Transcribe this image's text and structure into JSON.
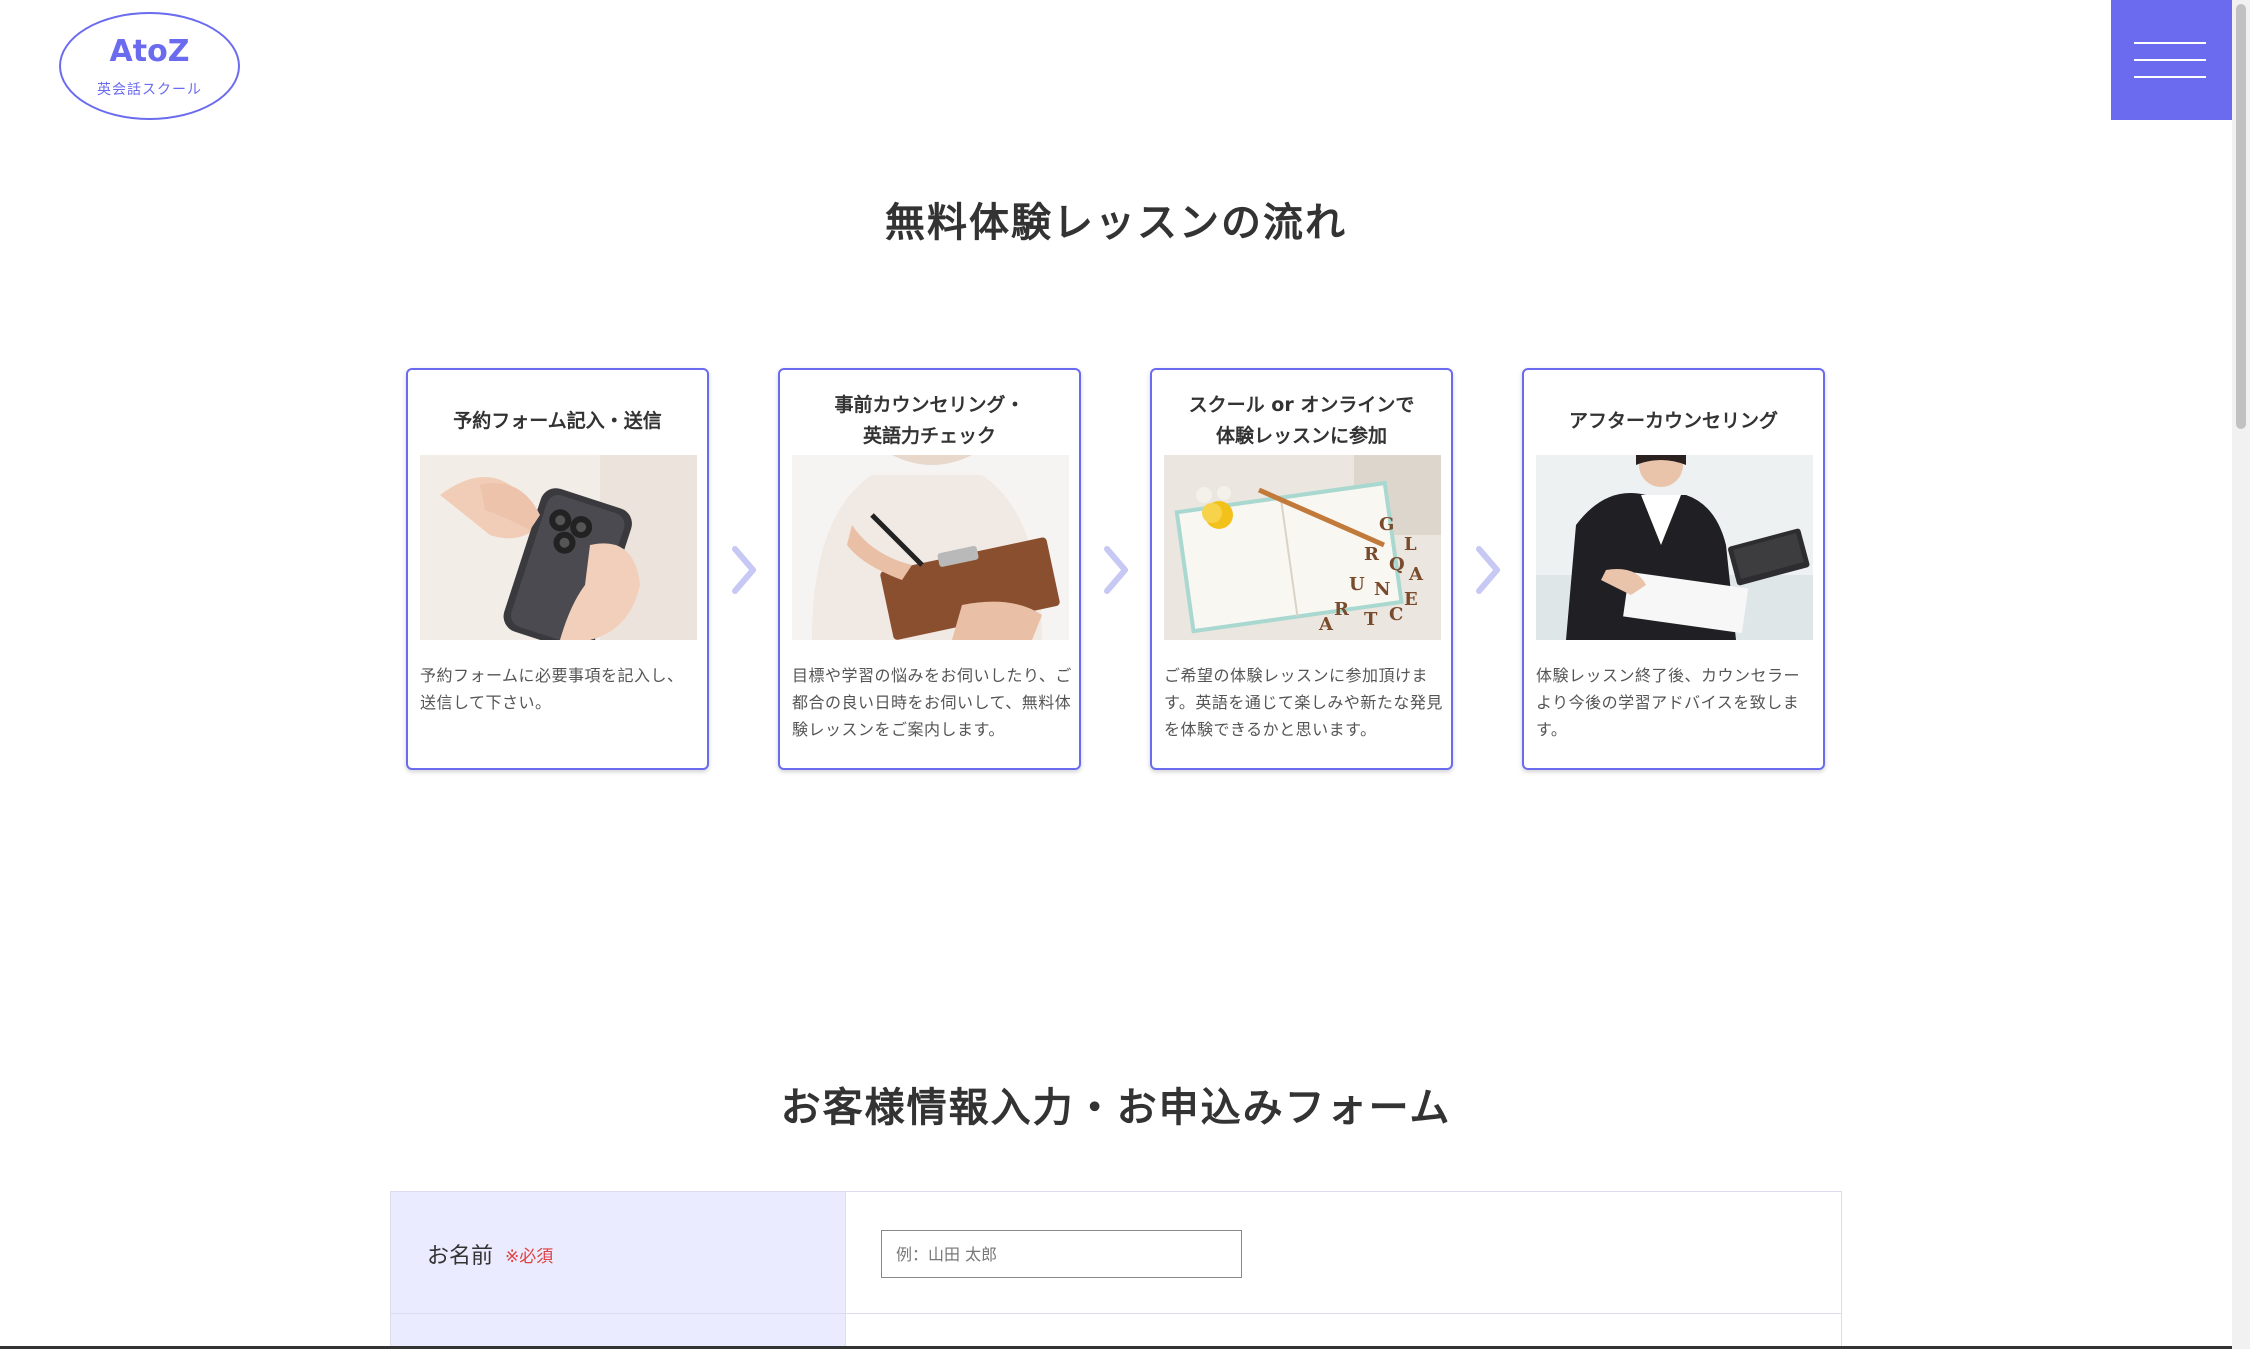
{
  "header": {
    "logo_main": "AtoZ",
    "logo_sub": "英会話スクール",
    "menu_icon": "hamburger-menu-icon"
  },
  "flow_section": {
    "title": "無料体験レッスンの流れ",
    "steps": [
      {
        "title": "予約フォーム記入・送信",
        "image": "hand-holding-smartphone",
        "text": "予約フォームに必要事項を記入し、送信して下さい。"
      },
      {
        "title": "事前カウンセリング・\n英語力チェック",
        "image": "person-writing-on-clipboard",
        "text": "目標や学習の悩みをお伺いしたり、ご都合の良い日時をお伺いして、無料体験レッスンをご案内します。"
      },
      {
        "title": "スクール or オンラインで\n体験レッスンに参加",
        "image": "notebook-with-letters-and-flowers",
        "text": "ご希望の体験レッスンに参加頂けます。英語を通じて楽しみや新たな発見を体験できるかと思います。"
      },
      {
        "title": "アフターカウンセリング",
        "image": "businesswoman-at-desk",
        "text": "体験レッスン終了後、カウンセラーより今後の学習アドバイスを致します。"
      }
    ],
    "arrow_icon": "chevron-right-icon"
  },
  "form_section": {
    "title": "お客様情報入力・お申込みフォーム",
    "fields": [
      {
        "label": "お名前",
        "required": "※必須",
        "placeholder": "例：山田 太郎",
        "value": ""
      }
    ]
  },
  "colors": {
    "accent": "#6b6bef",
    "label_bg": "#ebebff",
    "required": "#e04040",
    "arrow": "#c8c8f5"
  }
}
